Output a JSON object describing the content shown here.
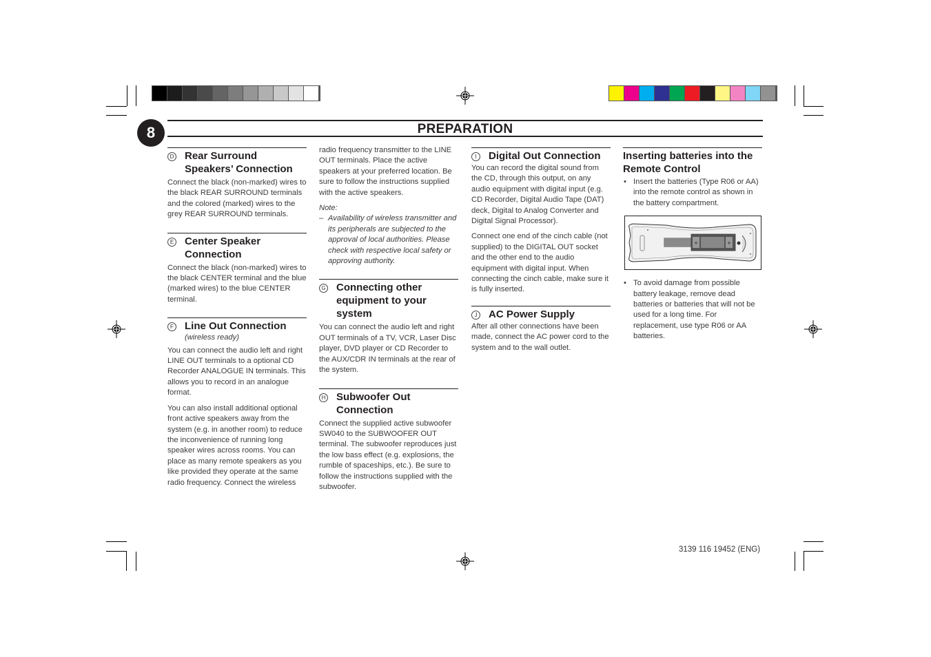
{
  "page": {
    "number": "8",
    "title": "PREPARATION",
    "footer_code": "3139 116 19452 (ENG)"
  },
  "print_marks": {
    "gray_swatches": [
      "#000000",
      "#1c1c1c",
      "#333333",
      "#4a4a4a",
      "#646464",
      "#7d7d7d",
      "#969696",
      "#b0b0b0",
      "#c9c9c9",
      "#e3e3e3",
      "#ffffff"
    ],
    "color_swatches": [
      "#fff200",
      "#ec008c",
      "#00aeef",
      "#2e3192",
      "#00a651",
      "#ed1c24",
      "#231f20",
      "#fff685",
      "#f384c4",
      "#7fd6f7",
      "#929292"
    ]
  },
  "columns": [
    {
      "sections": [
        {
          "letter": "D",
          "heading": "Rear Surround Speakers’ Connection",
          "paragraphs": [
            "Connect the black (non-marked) wires to the black REAR SURROUND terminals and the colored (marked) wires to the grey REAR SURROUND terminals."
          ]
        },
        {
          "letter": "E",
          "heading": "Center Speaker Connection",
          "paragraphs": [
            "Connect the black (non-marked) wires to the black CENTER terminal and the blue (marked wires) to the blue CENTER terminal."
          ]
        },
        {
          "letter": "F",
          "heading": "Line Out Connection",
          "subheading": "(wireless ready)",
          "paragraphs": [
            "You can connect the audio left and right LINE OUT terminals to a optional CD Recorder ANALOGUE IN terminals. This allows you to record in an analogue format.",
            "You can also install additional optional front active speakers away from the system (e.g. in another room) to reduce the inconvenience of running long speaker wires across rooms. You can place as many remote speakers as you like provided they operate at the same radio frequency. Connect the wireless"
          ]
        }
      ]
    },
    {
      "continued_paragraph": "radio frequency transmitter to the LINE OUT terminals. Place the active speakers at your preferred location. Be sure to follow the instructions supplied with the active speakers.",
      "note_label": "Note:",
      "note_dash": "–",
      "note_text": "Availability of wireless transmitter and its peripherals are subjected to the approval of local authorities. Please check with respective local safety or approving authority.",
      "sections": [
        {
          "letter": "G",
          "heading": "Connecting other equipment to your system",
          "paragraphs": [
            "You can connect the audio left and right OUT terminals of a  TV, VCR, Laser Disc player, DVD player or CD Recorder to the AUX/CDR IN terminals at the rear of the system."
          ]
        },
        {
          "letter": "H",
          "heading": "Subwoofer Out Connection",
          "paragraphs": [
            "Connect the supplied active subwoofer SW040 to the SUBWOOFER OUT terminal. The subwoofer reproduces just the low bass effect (e.g. explosions, the rumble of spaceships, etc.). Be sure to follow the instructions supplied with the subwoofer."
          ]
        }
      ]
    },
    {
      "sections": [
        {
          "letter": "I",
          "heading": "Digital Out Connection",
          "paragraphs": [
            "You can record the digital sound from the CD, through this output, on any audio equipment with digital input (e.g. CD Recorder, Digital Audio Tape (DAT) deck, Digital to Analog Converter and Digital Signal Processor).",
            "Connect one end of the cinch cable (not supplied) to the DIGITAL OUT socket and the other end to the audio equipment with digital input. When connecting the cinch cable, make sure it is fully inserted."
          ]
        },
        {
          "letter": "J",
          "heading": "AC Power Supply",
          "paragraphs": [
            "After all other connections have been made, connect the AC power cord to the system and to the wall outlet."
          ]
        }
      ]
    },
    {
      "heading": "Inserting batteries into the Remote Control",
      "bullet_symbol": "•",
      "bullets": [
        "Insert the batteries  (Type R06 or AA)  into the remote control as shown in the battery compartment.",
        "To avoid damage from possible battery leakage, remove dead batteries or batteries that will not be used for a long time. For replacement, use type R06 or AA batteries."
      ],
      "figure": {
        "description": "remote control battery compartment illustration",
        "battery_plus": "+",
        "battery_minus": "−"
      }
    }
  ]
}
